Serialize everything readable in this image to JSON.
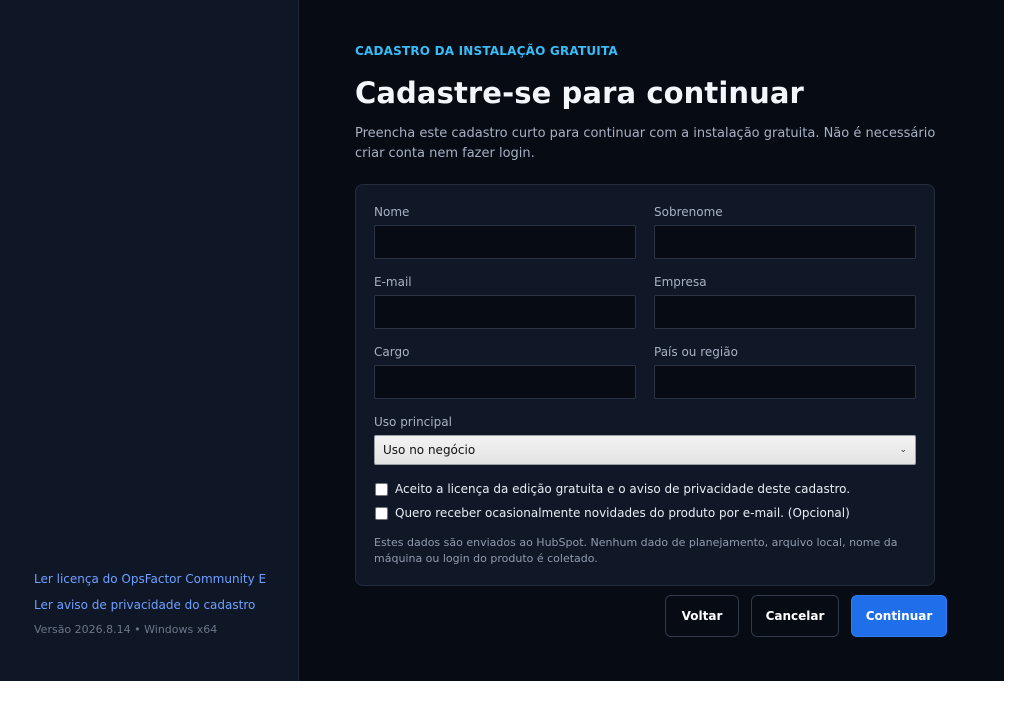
{
  "sidebar": {
    "links": [
      {
        "label": "Ler licença do OpsFactor Community Edition"
      },
      {
        "label": "Ler aviso de privacidade do cadastro"
      }
    ],
    "version": "Versão 2026.8.14 • Windows x64"
  },
  "header": {
    "eyebrow": "CADASTRO DA INSTALAÇÃO GRATUITA",
    "title": "Cadastre-se para continuar",
    "subtitle": "Preencha este cadastro curto para continuar com a instalação gratuita. Não é necessário criar conta nem fazer login."
  },
  "form": {
    "first_name": {
      "label": "Nome",
      "value": ""
    },
    "last_name": {
      "label": "Sobrenome",
      "value": ""
    },
    "email": {
      "label": "E-mail",
      "value": ""
    },
    "company": {
      "label": "Empresa",
      "value": ""
    },
    "job_title": {
      "label": "Cargo",
      "value": ""
    },
    "country": {
      "label": "País ou região",
      "value": ""
    },
    "primary_use": {
      "label": "Uso principal",
      "selected": "Uso no negócio"
    },
    "accept_license": {
      "label": "Aceito a licença da edição gratuita e o aviso de privacidade deste cadastro.",
      "checked": false
    },
    "newsletter": {
      "label": "Quero receber ocasionalmente novidades do produto por e-mail. (Opcional)",
      "checked": false
    },
    "note": "Estes dados são enviados ao HubSpot. Nenhum dado de planejamento, arquivo local, nome da máquina ou login do produto é coletado."
  },
  "actions": {
    "back": "Voltar",
    "cancel": "Cancelar",
    "continue": "Continuar"
  },
  "colors": {
    "accent": "#1f6feb",
    "eyebrow": "#38bdf8",
    "link": "#6ea0ff",
    "background": "#070b14",
    "sidebar": "#0f1626"
  }
}
